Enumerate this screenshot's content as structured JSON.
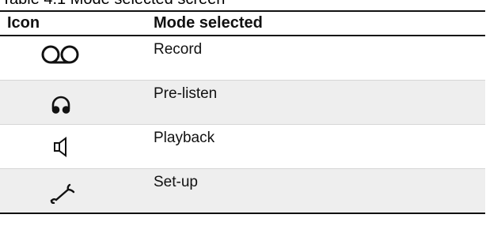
{
  "caption": "Table 4.1 Mode selected screen",
  "table": {
    "headers": {
      "icon": "Icon",
      "mode": "Mode selected"
    },
    "rows": [
      {
        "icon": "cassette-reels-icon",
        "mode": "Record",
        "shaded": false
      },
      {
        "icon": "headphones-icon",
        "mode": "Pre-listen",
        "shaded": true
      },
      {
        "icon": "speaker-icon",
        "mode": "Playback",
        "shaded": false
      },
      {
        "icon": "wrench-icon",
        "mode": "Set-up",
        "shaded": true
      }
    ]
  },
  "colors": {
    "rule": "#111111",
    "shade": "#eeeeee",
    "text": "#111111"
  }
}
